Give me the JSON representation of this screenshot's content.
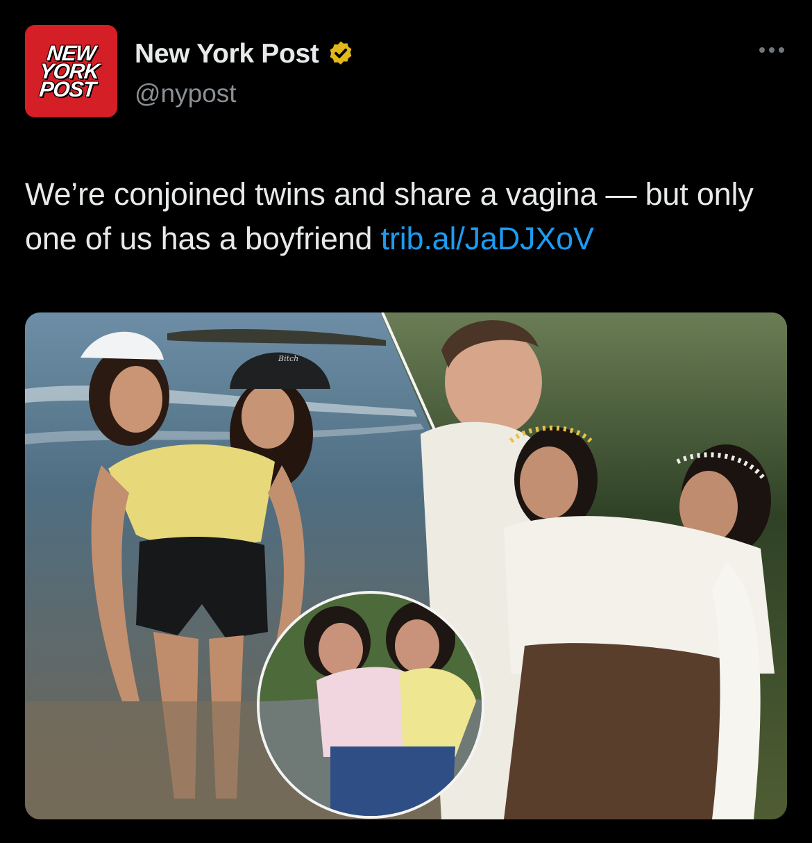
{
  "account": {
    "avatar_logo": "NEW\nYORK\nPOST",
    "display_name": "New York Post",
    "verified_badge_icon": "verified-badge-icon",
    "handle": "@nypost"
  },
  "tweet": {
    "text": "We’re conjoined twins and share a vagina — but only one of us has a boyfriend ",
    "link": "trib.al/JaDJXoV"
  },
  "media": {
    "hat_text": "Bitch"
  },
  "colors": {
    "background": "#000000",
    "text": "#e7e9ea",
    "muted": "#71767b",
    "link": "#1d9bf0",
    "brand_red": "#d41f26",
    "verified_gold": "#e2b719"
  }
}
